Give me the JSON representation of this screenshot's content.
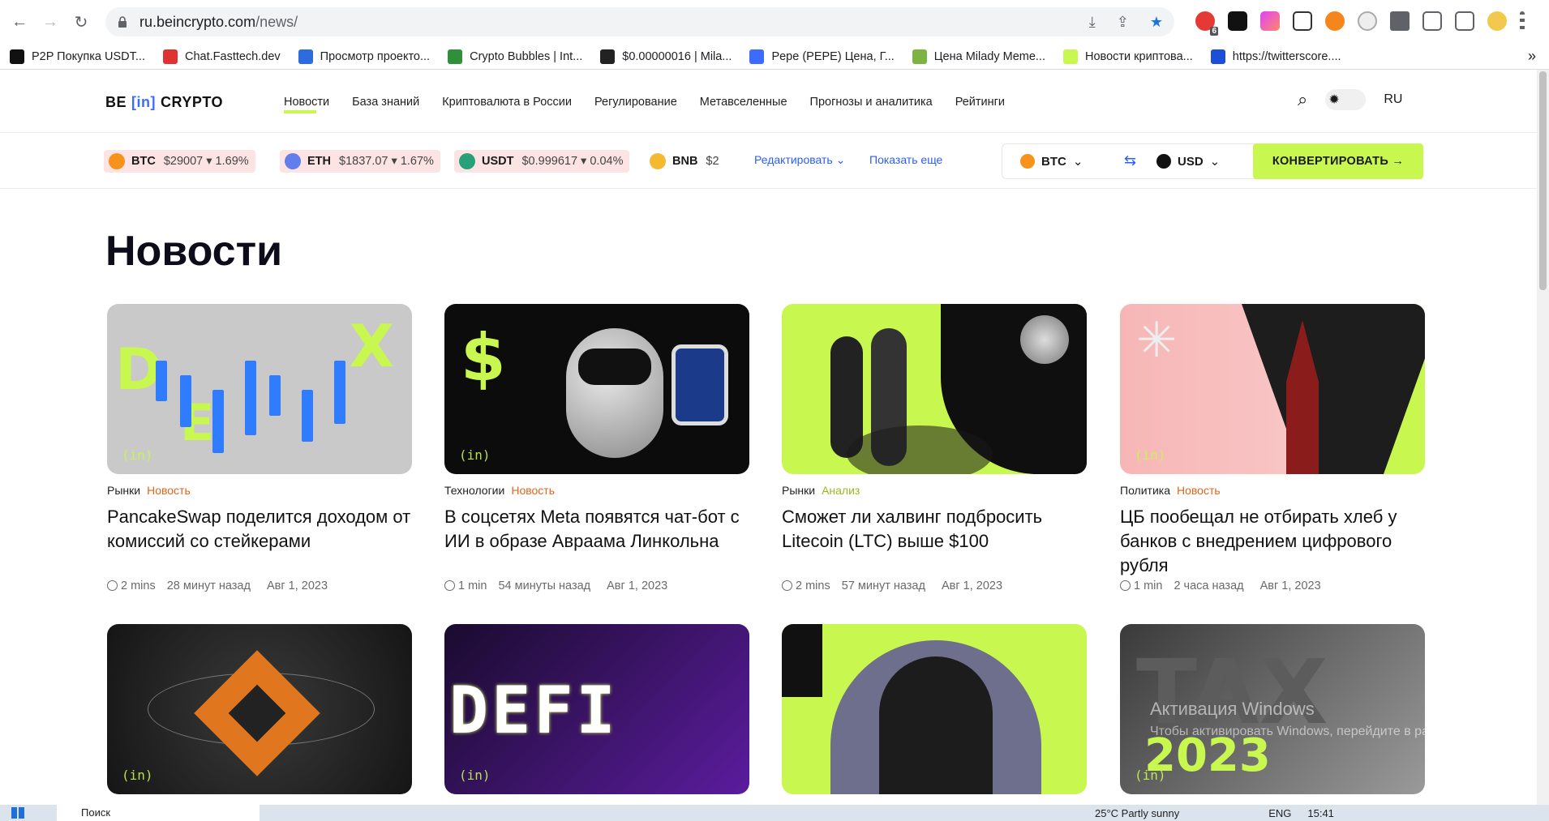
{
  "browser": {
    "url_domain": "ru.beincrypto.com",
    "url_path": "/news/",
    "bookmarks": [
      {
        "label": "P2P Покупка USDT...",
        "color": "#111"
      },
      {
        "label": "Chat.Fasttech.dev",
        "color": "#d33"
      },
      {
        "label": "Просмотр проекто...",
        "color": "#2d6cdf"
      },
      {
        "label": "Crypto Bubbles | Int...",
        "color": "#2f8f3a"
      },
      {
        "label": "$0.00000016 | Mila...",
        "color": "#222"
      },
      {
        "label": "Pepe (PEPE) Цена, Г...",
        "color": "#3b6cff"
      },
      {
        "label": "Цена Milady Meme...",
        "color": "#7cb342"
      },
      {
        "label": "Новости криптова...",
        "color": "#c8f750"
      },
      {
        "label": "https://twitterscore....",
        "color": "#1d4ed8"
      }
    ],
    "more_bookmarks": "»",
    "badge": "6"
  },
  "site": {
    "logo_left": "BE",
    "logo_mid": "[in]",
    "logo_right": "CRYPTO",
    "nav": [
      "Новости",
      "База знаний",
      "Криптовалюта в России",
      "Регулирование",
      "Метавселенные",
      "Прогнозы и аналитика",
      "Рейтинги"
    ],
    "lang": "RU"
  },
  "ticker": {
    "coins": [
      {
        "sym": "BTC",
        "value": "$29007 ▾ 1.69%",
        "color": "#f7931a"
      },
      {
        "sym": "ETH",
        "value": "$1837.07 ▾ 1.67%",
        "color": "#627eea"
      },
      {
        "sym": "USDT",
        "value": "$0.999617 ▾ 0.04%",
        "color": "#26a17b"
      },
      {
        "sym": "BNB",
        "value": "$2",
        "color": "#f3ba2f"
      }
    ],
    "edit": "Редактировать",
    "show_more": "Показать еще",
    "from": "BTC",
    "to": "USD",
    "convert": "КОНВЕРТИРОВАТЬ →"
  },
  "page": {
    "title": "Новости"
  },
  "articles": [
    {
      "cat": "Рынки",
      "kind": "Новость",
      "title": "PancakeSwap поделится доходом от комиссий со стейкерами",
      "read": "2 mins",
      "ago": "28 минут назад",
      "date": "Авг 1, 2023",
      "thumb": "dex"
    },
    {
      "cat": "Технологии",
      "kind": "Новость",
      "title": "В соцсетях Meta появятся чат-бот с ИИ в образе Авраама Линкольна",
      "read": "1 min",
      "ago": "54 минуты назад",
      "date": "Авг 1, 2023",
      "thumb": "robot"
    },
    {
      "cat": "Рынки",
      "kind": "Анализ",
      "title": "Сможет ли халвинг подбросить Litecoin (LTC) выше $100",
      "read": "2 mins",
      "ago": "57 минут назад",
      "date": "Авг 1, 2023",
      "thumb": "ltc"
    },
    {
      "cat": "Политика",
      "kind": "Новость",
      "title": "ЦБ пообещал не отбирать хлеб у банков с внедрением цифрового рубля",
      "read": "1 min",
      "ago": "2 часа назад",
      "date": "Авг 1, 2023",
      "thumb": "kremlin"
    },
    {
      "thumb": "bnb"
    },
    {
      "thumb": "defi",
      "label": "DEFI"
    },
    {
      "thumb": "hacker"
    },
    {
      "thumb": "tax",
      "label": "TAX",
      "label2": "2023"
    }
  ],
  "os": {
    "search": "Поиск",
    "weather": "25°C Partly sunny",
    "lang": "ENG",
    "time": "15:41",
    "activation": "Активация Windows",
    "activation_sub": "Чтобы активировать Windows, перейдите в раздел"
  }
}
